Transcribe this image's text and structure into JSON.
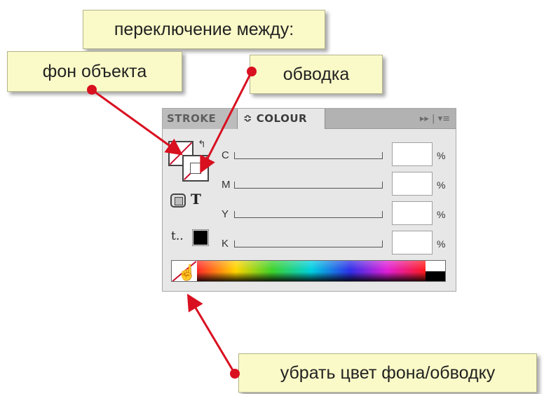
{
  "callouts": {
    "switch": "переключение между:",
    "fill": "фон объекта",
    "stroke": "обводка",
    "none": "убрать цвет фона/обводку"
  },
  "panel": {
    "tabs": [
      "STROKE",
      "≎ COLOUR"
    ],
    "menu": "▸▸ | ▾≡",
    "sliders": [
      {
        "label": "C",
        "value": "",
        "unit": "%"
      },
      {
        "label": "M",
        "value": "",
        "unit": "%"
      },
      {
        "label": "Y",
        "value": "",
        "unit": "%"
      },
      {
        "label": "K",
        "value": "",
        "unit": "%"
      }
    ],
    "text_icon": "T",
    "apply_icon": "t..",
    "swap_icon": "↰"
  },
  "icons": {
    "fill": "fill-swatch-icon",
    "stroke": "stroke-swatch-icon",
    "container": "container-icon",
    "text": "text-icon",
    "none": "none-swatch-icon",
    "cursor": "hand-cursor-icon"
  },
  "colors": {
    "callout_bg": "#fafac8",
    "arrow": "#d81020",
    "none_slash": "#c8102e",
    "panel_bg": "#e7e7e7"
  }
}
